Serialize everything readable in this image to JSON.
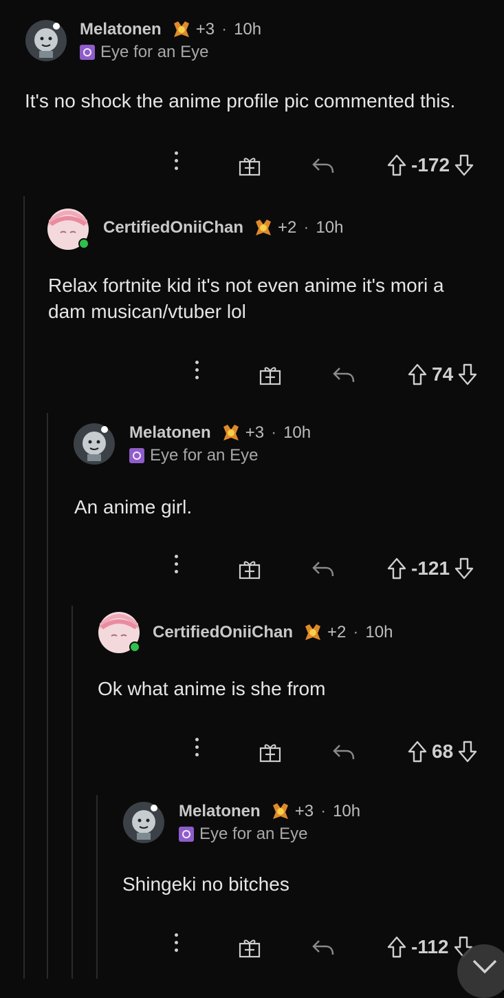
{
  "comments": [
    {
      "username": "Melatonen",
      "karma": "+3",
      "separator": "·",
      "time": "10h",
      "flair": "Eye for an Eye",
      "body": [
        "It's no shock the anime profile pic commented this."
      ],
      "score": "-172"
    },
    {
      "username": "CertifiedOniiChan",
      "karma": "+2",
      "separator": "·",
      "time": "10h",
      "flair": "",
      "body": [
        "Relax fortnite kid it's not even anime it's mori a",
        "dam musican/vtuber lol"
      ],
      "score": "74"
    },
    {
      "username": "Melatonen",
      "karma": "+3",
      "separator": "·",
      "time": "10h",
      "flair": "Eye for an Eye",
      "body": [
        "An anime girl."
      ],
      "score": "-121"
    },
    {
      "username": "CertifiedOniiChan",
      "karma": "+2",
      "separator": "·",
      "time": "10h",
      "flair": "",
      "body": [
        "Ok what anime is she from"
      ],
      "score": "68"
    },
    {
      "username": "Melatonen",
      "karma": "+3",
      "separator": "·",
      "time": "10h",
      "flair": "Eye for an Eye",
      "body": [
        "Shingeki no bitches"
      ],
      "score": "-112"
    }
  ],
  "icons": {
    "more": "more-options-icon",
    "award": "gift-award-icon",
    "reply": "reply-arrow-icon",
    "upvote": "upvote-arrow-icon",
    "downvote": "downvote-arrow-icon",
    "scroll": "chevron-down-icon"
  },
  "colors": {
    "background": "#0b0b0b",
    "flair": "#8f5dc9",
    "online": "#2fbf4a"
  }
}
